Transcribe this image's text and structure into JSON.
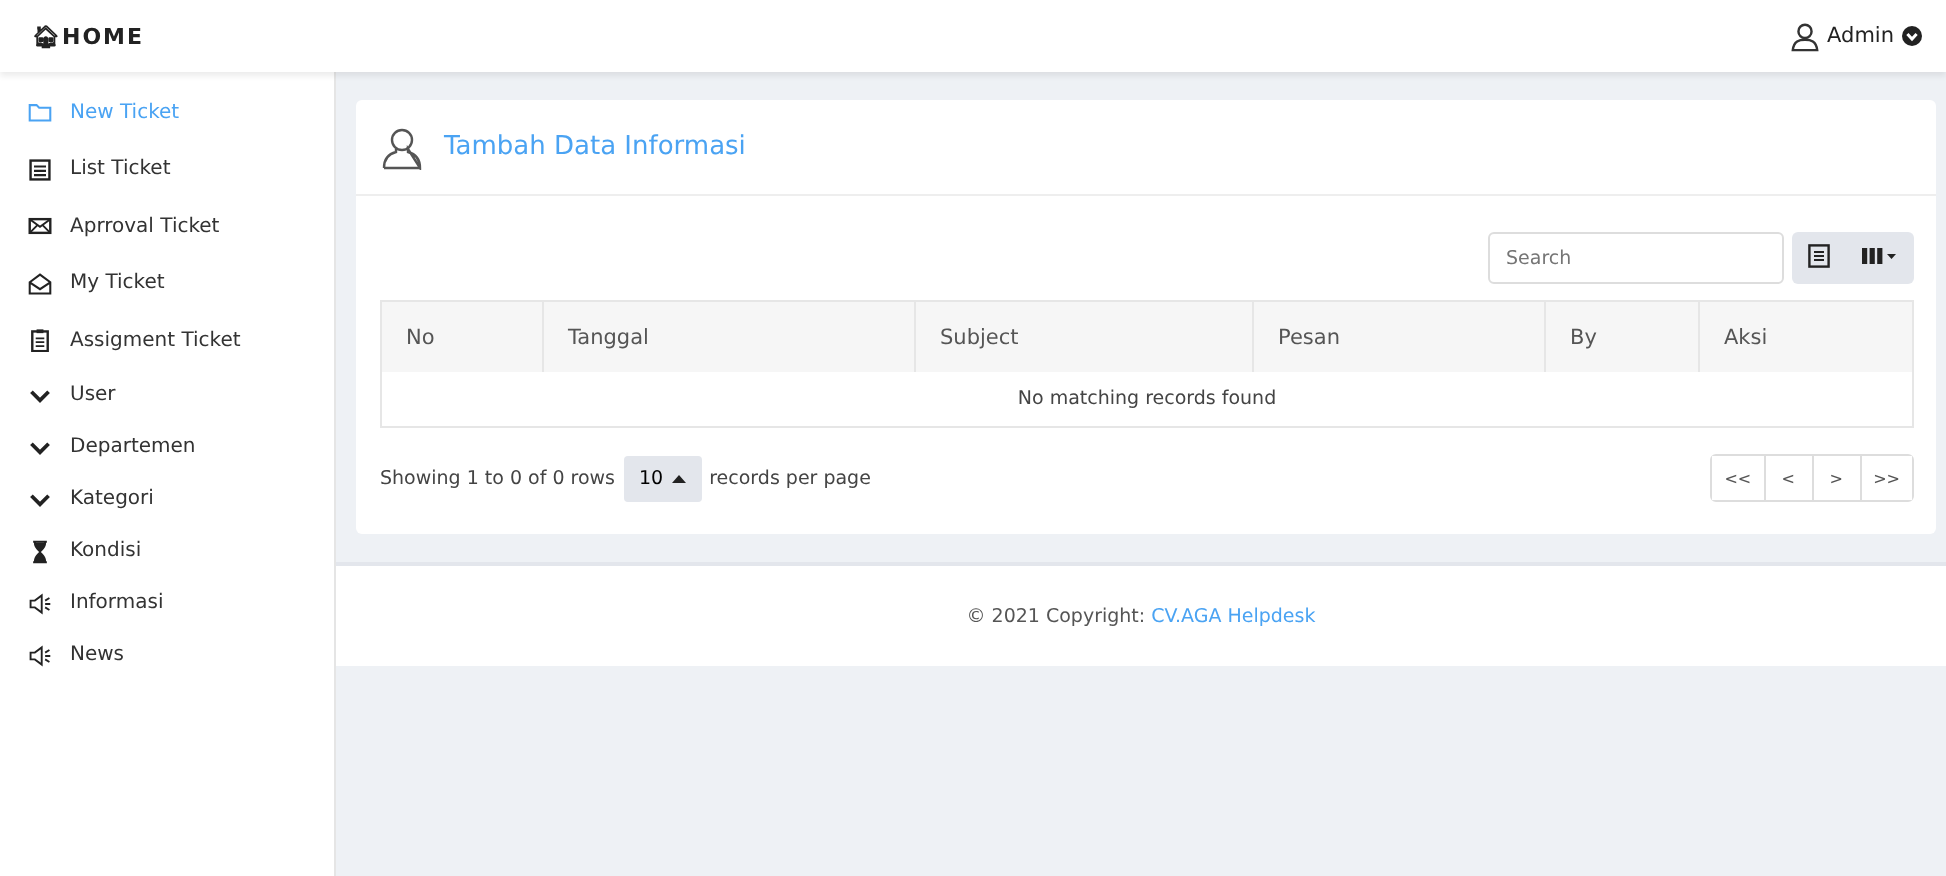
{
  "header": {
    "brand_icon": "🏠︎",
    "brand": "HOME",
    "user": "Admin"
  },
  "sidebar": {
    "items": [
      {
        "label": "New Ticket",
        "kind": "link",
        "selected": true
      },
      {
        "label": "List Ticket",
        "kind": "link",
        "selected": false
      },
      {
        "label": "Aprroval Ticket",
        "kind": "link",
        "selected": false
      },
      {
        "label": "My Ticket",
        "kind": "link",
        "selected": false
      },
      {
        "label": "Assigment Ticket",
        "kind": "link",
        "selected": false
      },
      {
        "label": "User",
        "kind": "group",
        "selected": false
      },
      {
        "label": "Departemen",
        "kind": "group",
        "selected": false
      },
      {
        "label": "Kategori",
        "kind": "group",
        "selected": false
      },
      {
        "label": "Kondisi",
        "kind": "link",
        "selected": false
      },
      {
        "label": "Informasi",
        "kind": "link",
        "selected": false
      },
      {
        "label": "News",
        "kind": "link",
        "selected": false
      }
    ]
  },
  "card": {
    "title": "Tambah Data Informasi",
    "search": {
      "placeholder": "Search"
    },
    "table": {
      "columns": [
        "No",
        "Tanggal",
        "Subject",
        "Pesan",
        "By",
        "Aksi"
      ],
      "empty_message": "No matching records found"
    },
    "pagination": {
      "summary": "Showing 1 to 0 of 0 rows",
      "page_size": "10",
      "page_size_label": "records per page",
      "buttons": [
        "<<",
        "<",
        ">",
        ">>"
      ]
    }
  },
  "footer": {
    "text": "© 2021 Copyright: ",
    "link": "CV.AGA Helpdesk"
  }
}
